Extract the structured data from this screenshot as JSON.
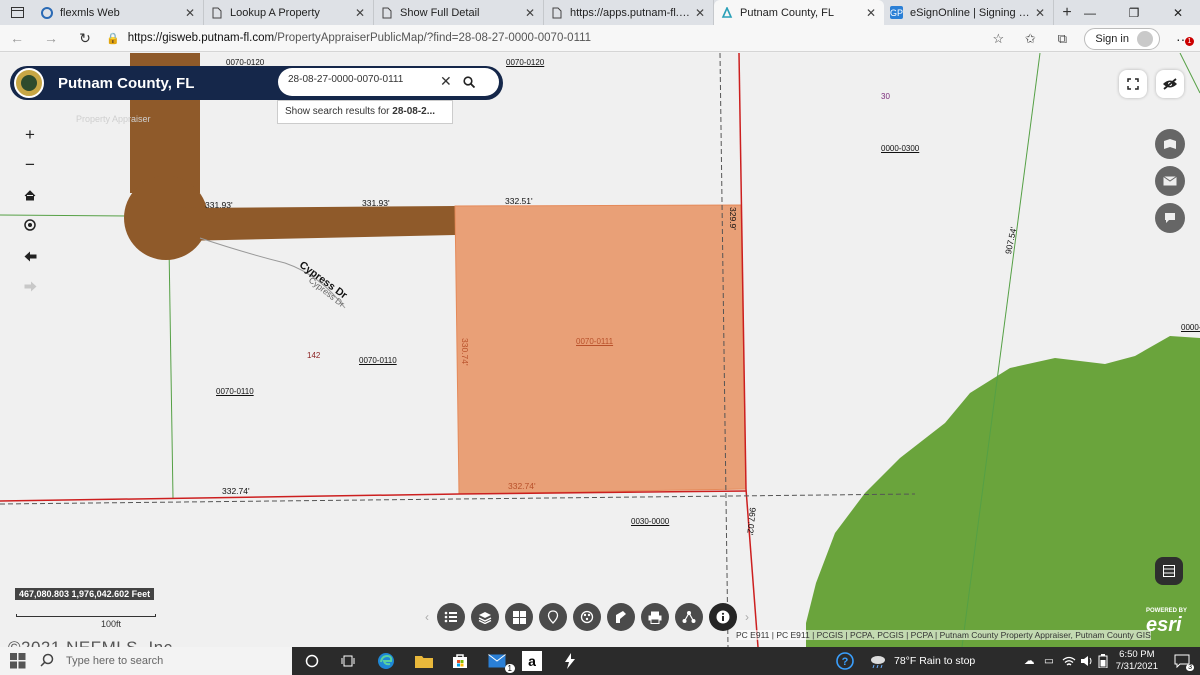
{
  "browser": {
    "tabs": [
      {
        "title": "flexmls Web",
        "favicon": "flexmls-icon",
        "active": false
      },
      {
        "title": "Lookup A Property",
        "favicon": "page-icon",
        "active": false
      },
      {
        "title": "Show Full Detail",
        "favicon": "page-icon",
        "active": false
      },
      {
        "title": "https://apps.putnam-fl.com/p",
        "favicon": "page-icon",
        "active": false
      },
      {
        "title": "Putnam County, FL",
        "favicon": "putnam-icon",
        "active": true
      },
      {
        "title": "eSignOnline | Signing Session",
        "favicon": "esign-icon",
        "active": false
      }
    ],
    "url": {
      "domain": "https://gisweb.putnam-fl.com",
      "path": "/PropertyAppraiserPublicMap/?find=28-08-27-0000-0070-0111"
    },
    "signin_label": "Sign in",
    "menu_badge": "1"
  },
  "map": {
    "app_title": "Putnam County, FL",
    "search": {
      "value": "28-08-27-0000-0070-0111"
    },
    "suggestion": {
      "prefix": "Show search results for ",
      "bold": "28-08-2..."
    },
    "faded_label": "Property Appraiser",
    "parcel_labels": {
      "p0070_0120_left": "0070-0120",
      "p0070_0120_right": "0070-0120",
      "p30": "30",
      "p0000_0300": "0000-0300",
      "p0070_0111": "0070-0111",
      "p142": "142",
      "p0070_0110_a": "0070-0110",
      "p0070_0110_b": "0070-0110",
      "p0030_0000": "0030-0000",
      "p0000_edge": "0000-0"
    },
    "dimensions": {
      "d331_93_a": "331.93'",
      "d331_93_b": "331.93'",
      "d332_51": "332.51'",
      "d329_9": "329.9'",
      "d907_54": "907.54'",
      "d330_74": "330.74'",
      "d332_74_a": "332.74'",
      "d332_74_b": "332.74'",
      "d967_02": "967.02'"
    },
    "street_labels": {
      "main": "Cypress Dr",
      "sub": "Cypress Dr"
    },
    "coordinates": "467,080.803 1,976,042.602 Feet",
    "scale_label": "100ft",
    "attribution": "PC E911 | PC E911 | PCGIS | PCPA, PCGIS | PCPA | Putnam County Property Appraiser, Putnam County GIS",
    "esri": {
      "powered": "POWERED BY",
      "logo": "esri"
    },
    "copyright": "©2021 NEFMLS, Inc.",
    "colors": {
      "selected_parcel": "#e9a077",
      "road": "#8f5a2a",
      "green_area": "#6aa43c",
      "boundary_red": "#cc1f1f",
      "header_navy": "#15274a"
    }
  },
  "taskbar": {
    "search_placeholder": "Type here to search",
    "weather": "78°F  Rain to stop",
    "time": "6:50 PM",
    "date": "7/31/2021",
    "notification_count": "3",
    "mail_badge": "1"
  }
}
